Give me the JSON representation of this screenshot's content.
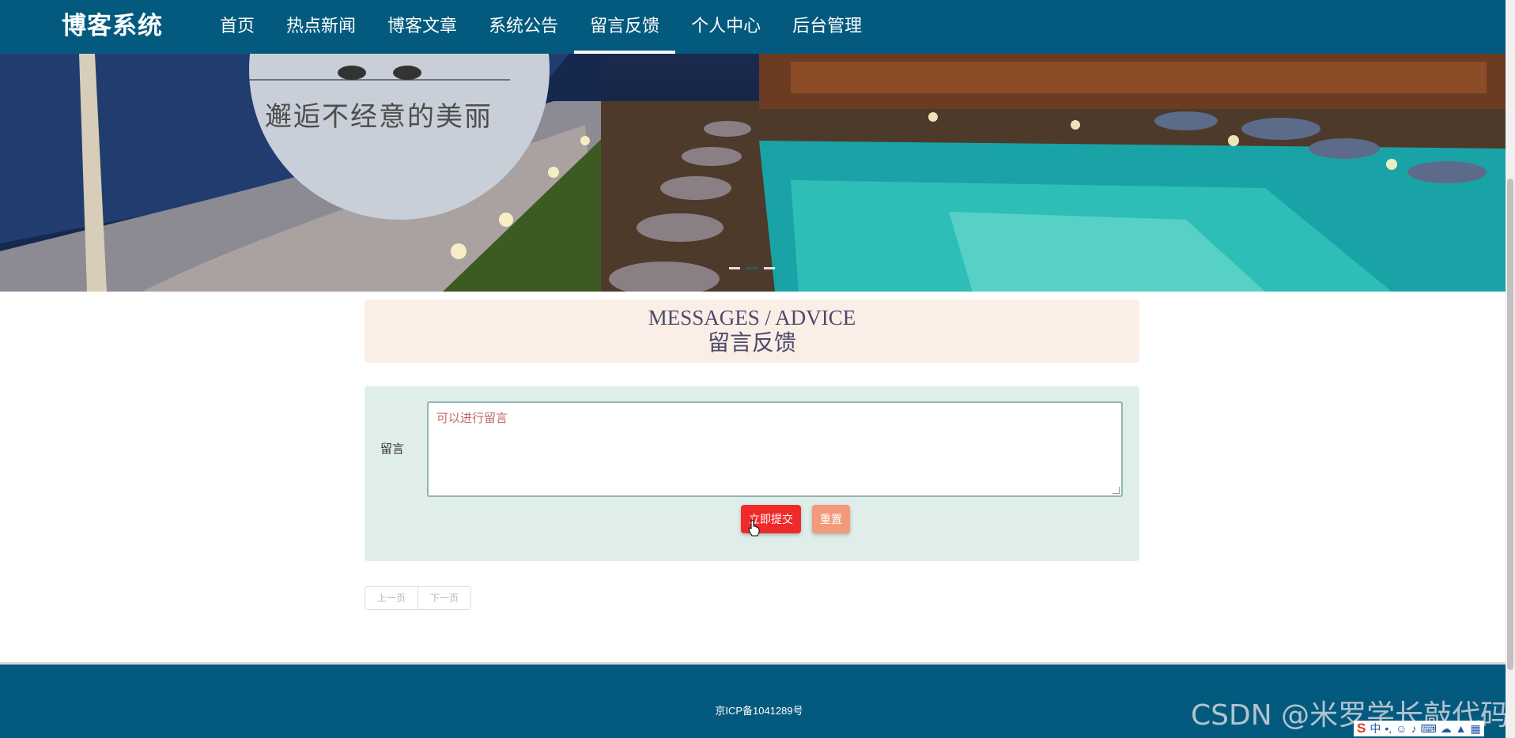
{
  "nav": {
    "brand": "博客系统",
    "items": [
      {
        "label": "首页",
        "active": false
      },
      {
        "label": "热点新闻",
        "active": false
      },
      {
        "label": "博客文章",
        "active": false
      },
      {
        "label": "系统公告",
        "active": false
      },
      {
        "label": "留言反馈",
        "active": true
      },
      {
        "label": "个人中心",
        "active": false
      },
      {
        "label": "后台管理",
        "active": false
      }
    ]
  },
  "banner": {
    "slogan": "邂逅不经意的美丽",
    "active_slide_index": 1,
    "slide_count": 3
  },
  "section": {
    "title_en": "MESSAGES / ADVICE",
    "title_cn": "留言反馈"
  },
  "form": {
    "label": "留言",
    "placeholder": "可以进行留言",
    "submit_label": "立即提交",
    "reset_label": "重置"
  },
  "pager": {
    "prev_label": "上一页",
    "next_label": "下一页"
  },
  "footer": {
    "icp": "京ICP备1041289号"
  },
  "watermark": "CSDN @米罗学长敲代码",
  "tray": {
    "ime_logo": "S",
    "ime_mode": "中",
    "icons": [
      "punctuation-icon",
      "emoji-icon",
      "microphone-icon",
      "keyboard-icon",
      "skin-icon",
      "toolbox-icon",
      "grid-icon"
    ]
  },
  "colors": {
    "nav_bg": "#045a7e",
    "title_bg": "#fbeee6",
    "form_bg": "#e0eeea",
    "submit_bg": "#f02a2a",
    "reset_bg": "#f29a7b"
  }
}
